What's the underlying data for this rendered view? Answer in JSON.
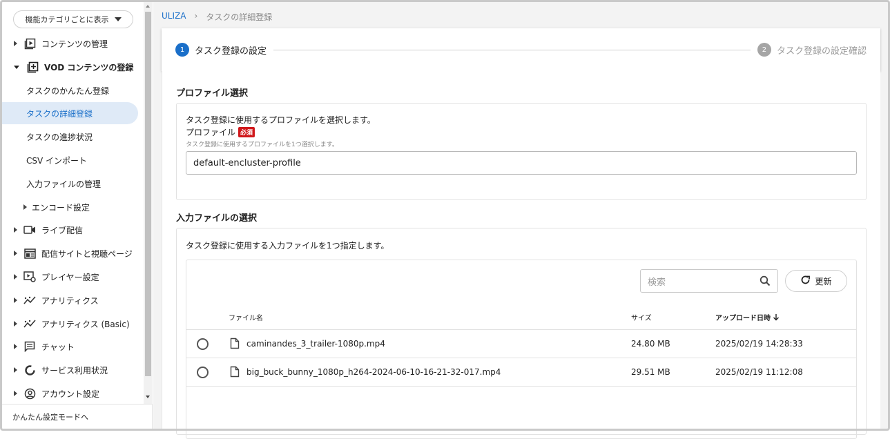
{
  "sidebar": {
    "category_dropdown": "機能カテゴリごとに表示",
    "items": [
      {
        "label": "コンテンツの管理",
        "icon": "play-box-icon"
      },
      {
        "label": "VOD コンテンツの登録",
        "icon": "add-box-icon"
      },
      {
        "label": "ライブ配信",
        "icon": "video-camera-icon"
      },
      {
        "label": "配信サイトと視聴ページ",
        "icon": "web-page-icon"
      },
      {
        "label": "プレイヤー設定",
        "icon": "player-settings-icon"
      },
      {
        "label": "アナリティクス",
        "icon": "analytics-icon"
      },
      {
        "label": "アナリティクス (Basic)",
        "icon": "analytics-basic-icon"
      },
      {
        "label": "チャット",
        "icon": "chat-icon"
      },
      {
        "label": "サービス利用状況",
        "icon": "usage-donut-icon"
      },
      {
        "label": "アカウント設定",
        "icon": "account-icon"
      }
    ],
    "vod_sub_items": [
      "タスクのかんたん登録",
      "タスクの詳細登録",
      "タスクの進捗状況",
      "CSV インポート",
      "入力ファイルの管理",
      "エンコード設定"
    ],
    "footer": "かんたん設定モードへ"
  },
  "breadcrumb": {
    "root": "ULIZA",
    "separator": "›",
    "current": "タスクの詳細登録"
  },
  "stepper": [
    {
      "num": "1",
      "label": "タスク登録の設定"
    },
    {
      "num": "2",
      "label": "タスク登録の設定確認"
    }
  ],
  "profile_section": {
    "title": "プロファイル選択",
    "description": "タスク登録に使用するプロファイルを選択します。",
    "field_label": "プロファイル",
    "required_badge": "必須",
    "hint": "タスク登録に使用するプロファイルを1つ選択します。",
    "value": "default-encluster-profile"
  },
  "input_section": {
    "title": "入力ファイルの選択",
    "description": "タスク登録に使用する入力ファイルを1つ指定します。",
    "search_placeholder": "検索",
    "refresh_label": "更新",
    "columns": {
      "name": "ファイル名",
      "size": "サイズ",
      "date": "アップロード日時"
    },
    "rows": [
      {
        "name": "caminandes_3_trailer-1080p.mp4",
        "size": "24.80 MB",
        "date": "2025/02/19 14:28:33"
      },
      {
        "name": "big_buck_bunny_1080p_h264-2024-06-10-16-21-32-017.mp4",
        "size": "29.51 MB",
        "date": "2025/02/19 11:12:08"
      }
    ]
  },
  "colors": {
    "accent": "#1a6fc9",
    "active_bg": "#dfeaf7",
    "required": "#d0181b"
  }
}
